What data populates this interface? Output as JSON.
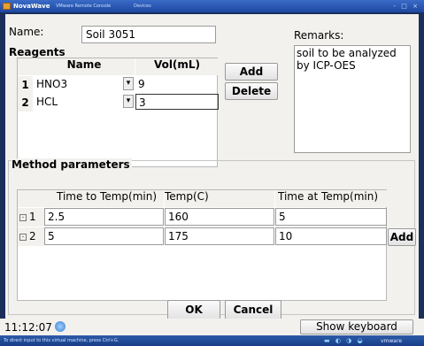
{
  "window": {
    "title": "NovaWave",
    "subtitle": "VMware Remote Console",
    "menu": "Devices",
    "controls": "- □ ×"
  },
  "form": {
    "name_label": "Name:",
    "name_value": "Soil 3051",
    "remarks_label": "Remarks:",
    "remarks_value": "soil to be analyzed\nby ICP-OES"
  },
  "reagents": {
    "title": "Reagents",
    "col_name": "Name",
    "col_vol": "Vol(mL)",
    "rows": [
      {
        "num": "1",
        "name": "HNO3",
        "vol": "9"
      },
      {
        "num": "2",
        "name": "HCL",
        "vol": "3"
      }
    ],
    "dropdown_glyph": "▾",
    "add_label": "Add",
    "delete_label": "Delete"
  },
  "method": {
    "title": "Method parameters",
    "col_time": "Time to Temp(min)",
    "col_temp": "Temp(C)",
    "col_hold": "Time at Temp(min)",
    "rows": [
      {
        "num": "1",
        "check": "-",
        "time": "2.5",
        "temp": "160",
        "hold": "5"
      },
      {
        "num": "2",
        "check": "-",
        "time": "5",
        "temp": "175",
        "hold": "10"
      }
    ],
    "add_label": "Add"
  },
  "footer": {
    "ok_label": "OK",
    "cancel_label": "Cancel",
    "clock": "11:12:07",
    "show_keyboard_label": "Show keyboard"
  },
  "taskbar": {
    "hint": "To direct input to this virtual machine, press Ctrl+G.",
    "tray": "▬ ◐ ◑ ◒",
    "brand": "vmware"
  }
}
